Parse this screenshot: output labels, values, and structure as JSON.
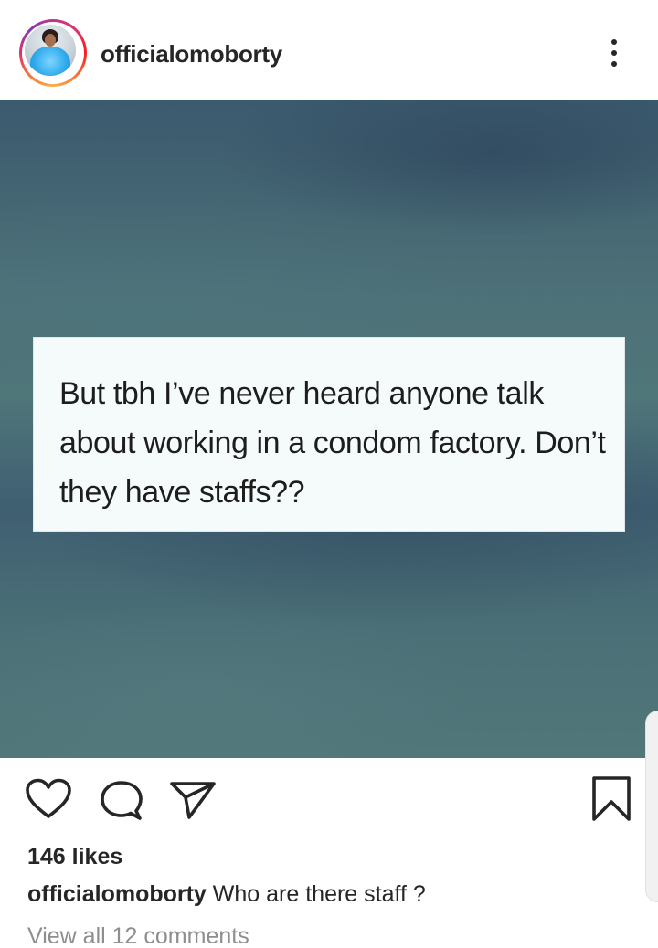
{
  "post": {
    "username": "officialomoborty",
    "avatar_icon": "profile-avatar",
    "menu_icon": "more-vertical-icon",
    "image_quote": "But tbh I’ve never heard anyone talk about working in a condom factory. Don’t they have staffs??",
    "actions": {
      "like_icon": "heart-icon",
      "comment_icon": "comment-bubble-icon",
      "share_icon": "paper-plane-icon",
      "save_icon": "bookmark-icon"
    },
    "likes": "146 likes",
    "caption_user": "officialomoborty",
    "caption_text": " Who are there staff ?",
    "view_comments": "View all 12 comments"
  },
  "colors": {
    "text": "#262626",
    "muted": "#8e8e8e",
    "image_bg": "#4d7178",
    "quote_bg": "#f5fbfb"
  }
}
